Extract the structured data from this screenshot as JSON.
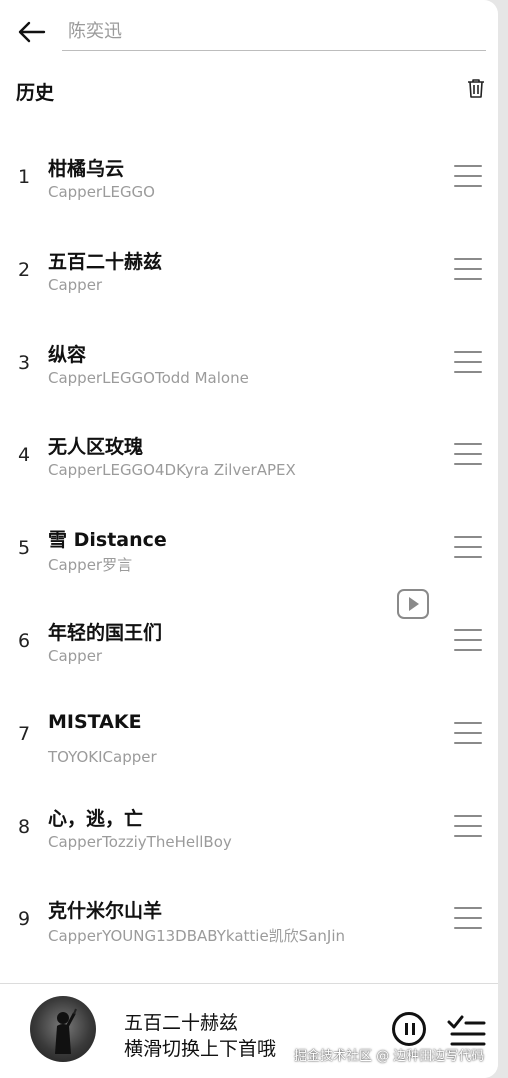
{
  "search": {
    "placeholder": "陈奕迅"
  },
  "history": {
    "title": "历史"
  },
  "songs": [
    {
      "index": "1",
      "title": "柑橘乌云",
      "artist": "CapperLEGGO"
    },
    {
      "index": "2",
      "title": "五百二十赫兹",
      "artist": "Capper"
    },
    {
      "index": "3",
      "title": "纵容",
      "artist": "CapperLEGGOTodd Malone"
    },
    {
      "index": "4",
      "title": "无人区玫瑰",
      "artist": "CapperLEGGO4DKyra ZilverAPEX"
    },
    {
      "index": "5",
      "title": "雪 Distance",
      "artist": "Capper罗言"
    },
    {
      "index": "6",
      "title": "年轻的国王们",
      "artist": "Capper"
    },
    {
      "index": "7",
      "title": "MISTAKE",
      "artist": "TOYOKICapper"
    },
    {
      "index": "8",
      "title": "心，逃，亡",
      "artist": "CapperTozziyTheHellBoy"
    },
    {
      "index": "9",
      "title": "克什米尔山羊",
      "artist": "CapperYOUNG13DBABYkattie凯欣SanJin"
    }
  ],
  "player": {
    "title": "五百二十赫兹",
    "subtitle": "横滑切换上下首哦"
  },
  "watermark": "掘金技术社区 @ 边种田边写代码",
  "icons": {
    "back": "arrow-left-icon",
    "trash": "trash-icon",
    "menu": "hamburger-icon",
    "video": "play-video-icon",
    "pause": "pause-icon",
    "playlist": "playlist-icon"
  },
  "colors": {
    "accent": "#111111",
    "secondary_text": "#9b9b9b",
    "icon_gray": "#8a8a8a"
  }
}
